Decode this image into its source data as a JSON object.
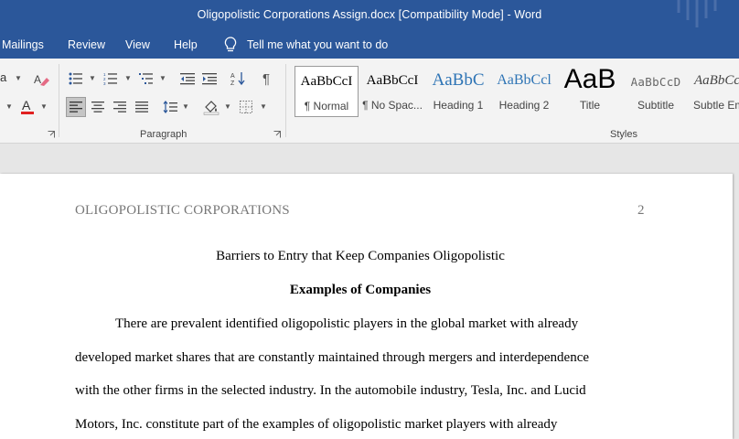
{
  "window": {
    "title": "Oligopolistic Corporations Assign.docx [Compatibility Mode]  -  Word"
  },
  "menu": {
    "tabs": [
      "Mailings",
      "Review",
      "View",
      "Help"
    ],
    "tell_me": "Tell me what you want to do"
  },
  "ribbon": {
    "paragraph_label": "Paragraph",
    "styles_label": "Styles",
    "styles": [
      {
        "sample": "AaBbCcI",
        "name": "¶ Normal"
      },
      {
        "sample": "AaBbCcI",
        "name": "¶ No Spac..."
      },
      {
        "sample": "AaBbC",
        "name": "Heading 1"
      },
      {
        "sample": "AaBbCcl",
        "name": "Heading 2"
      },
      {
        "sample": "AaB",
        "name": "Title"
      },
      {
        "sample": "AaBbCcD",
        "name": "Subtitle"
      },
      {
        "sample": "AaBbCcI",
        "name": "Subtle Em"
      }
    ],
    "font_fragment": "a"
  },
  "colors": {
    "word_blue": "#2b579a",
    "heading_blue": "#2e74b5",
    "font_color_red": "#e02020"
  },
  "document": {
    "running_head": "OLIGOPOLISTIC CORPORATIONS",
    "page_number": "2",
    "title": "Barriers to Entry that Keep Companies Oligopolistic",
    "subheading": "Examples of Companies",
    "lines": [
      "There are prevalent identified oligopolistic players in the global market with already",
      "developed market shares that are constantly maintained through mergers and interdependence",
      "with the other firms in the selected industry. In the automobile industry, Tesla, Inc. and Lucid",
      "Motors, Inc. constitute part of the examples of oligopolistic market players with already"
    ]
  }
}
